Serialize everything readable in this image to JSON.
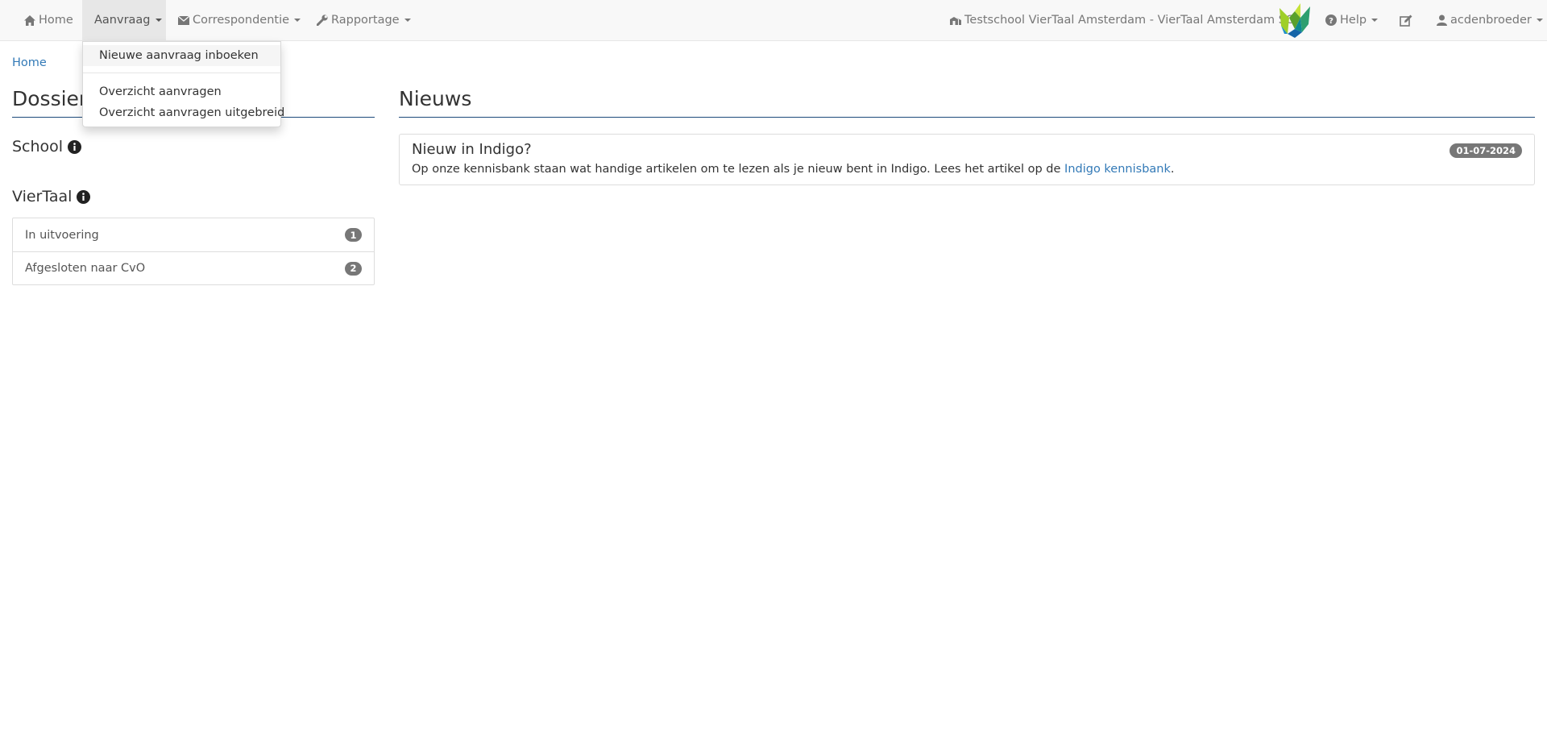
{
  "navbar": {
    "home_label": "Home",
    "aanvraag_label": "Aanvraag",
    "correspondentie_label": "Correspondentie",
    "rapportage_label": "Rapportage",
    "school_label": "Testschool VierTaal Amsterdam - VierTaal Amsterdam SO",
    "help_label": "Help",
    "user_label": "acdenbroeder",
    "icons": [
      "home-icon",
      "envelope-icon",
      "wrench-icon",
      "school-icon",
      "logo",
      "question-icon",
      "edit-icon",
      "user-icon"
    ]
  },
  "dropdown": {
    "items": [
      "Nieuwe aanvraag inboeken",
      "Overzicht aanvragen",
      "Overzicht aanvragen uitgebreid"
    ]
  },
  "breadcrumb": {
    "home": "Home"
  },
  "dossiers": {
    "title": "Dossiers",
    "school_title": "School",
    "viertaal_title": "VierTaal",
    "items": [
      {
        "label": "In uitvoering",
        "count": "1"
      },
      {
        "label": "Afgesloten naar CvO",
        "count": "2"
      }
    ]
  },
  "news": {
    "title": "Nieuws",
    "item": {
      "title": "Nieuw in Indigo?",
      "date": "01-07-2024",
      "body": "Op onze kennisbank staan wat handige artikelen om te lezen als je nieuw bent in Indigo. Lees het artikel op de ",
      "link_text": "Indigo kennisbank",
      "suffix": "."
    }
  },
  "colors": {
    "link": "#337ab7",
    "rule": "#1d4a7a",
    "badge": "#777777",
    "navbar_bg": "#f8f8f8"
  }
}
